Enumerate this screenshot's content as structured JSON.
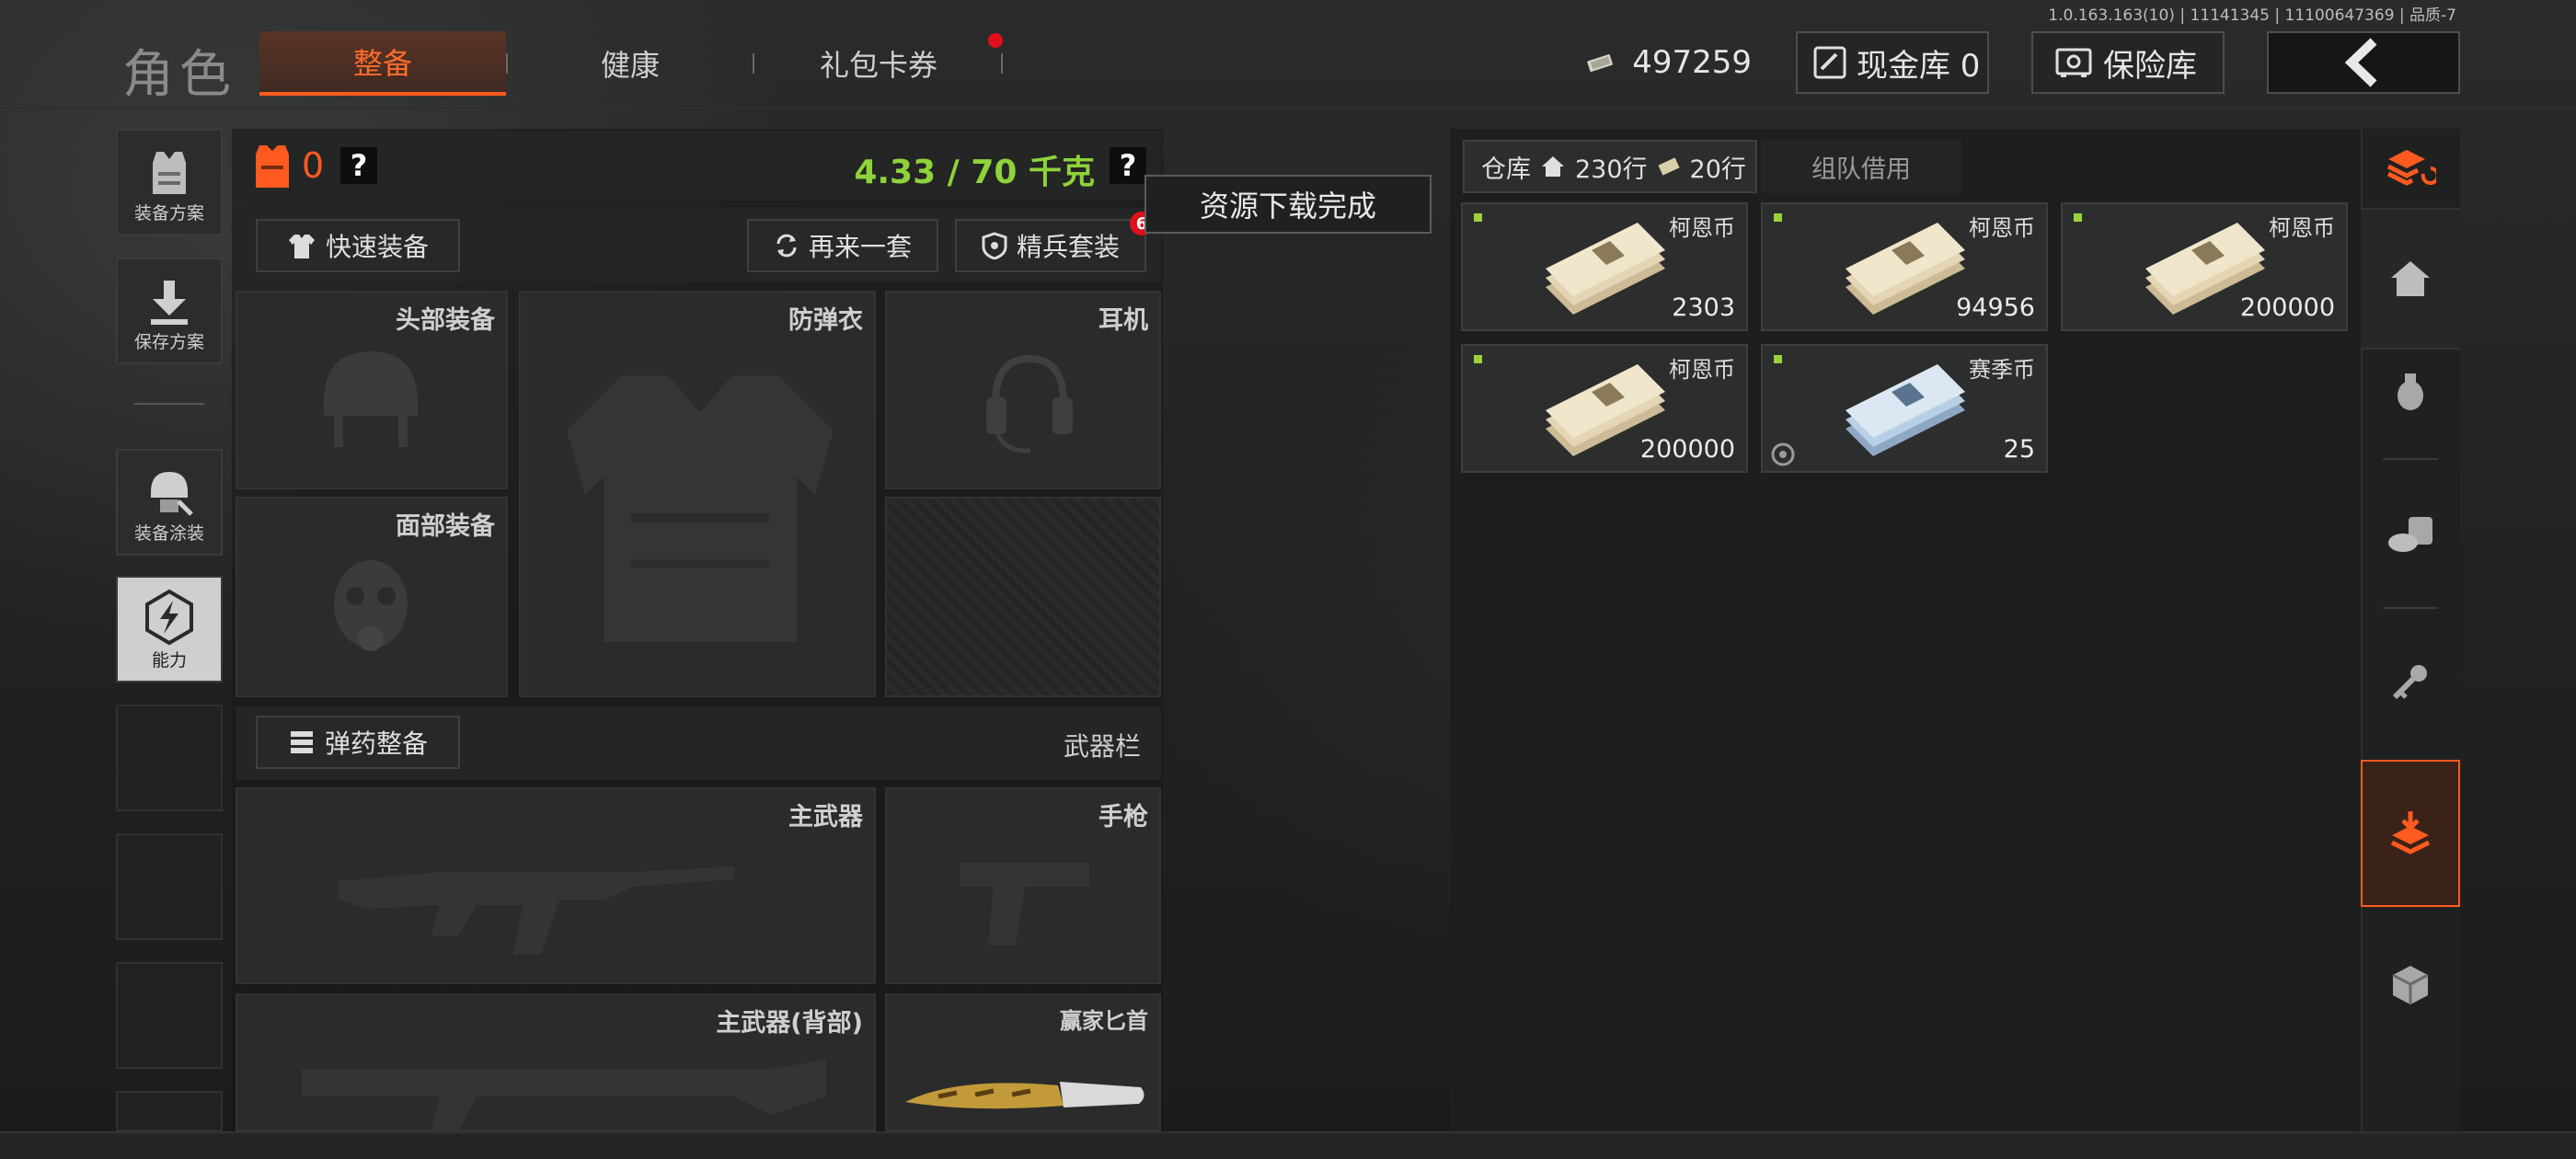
{
  "version_text": "1.0.163.163(10) | 11141345 | 11100647369 | 品质-7",
  "header": {
    "title": "角色",
    "tabs": [
      {
        "label": "整备",
        "active": true
      },
      {
        "label": "健康",
        "active": false
      },
      {
        "label": "礼包卡券",
        "active": false,
        "has_notification": true
      }
    ],
    "money": "497259",
    "cash_vault_label": "现金库 0",
    "safe_label": "保险库"
  },
  "side_menu": [
    {
      "label": "装备方案",
      "icon": "armor-vest-icon"
    },
    {
      "label": "保存方案",
      "icon": "download-icon"
    },
    {
      "label": "装备涂装",
      "icon": "helmet-paint-icon"
    },
    {
      "label": "能力",
      "icon": "lightning-hex-icon"
    }
  ],
  "loadout": {
    "armor_count": "0",
    "help_symbol": "?",
    "weight": "4.33 / 70 千克",
    "quick_equip_label": "快速装备",
    "again_label": "再来一套",
    "elite_set_label": "精兵套装",
    "elite_badge": "6",
    "slots": {
      "head": "头部装备",
      "vest": "防弹衣",
      "headset": "耳机",
      "face": "面部装备"
    },
    "ammo_label": "弹药整备",
    "weapon_bar_label": "武器栏",
    "weapons": {
      "primary": "主武器",
      "pistol": "手枪",
      "primary_back": "主武器(背部)",
      "melee": "赢家匕首"
    }
  },
  "toast": "资源下载完成",
  "warehouse": {
    "tab_label": "仓库",
    "rows_label": "230行",
    "extra_rows_label": "20行",
    "team_borrow_label": "组队借用",
    "items": [
      {
        "name": "柯恩币",
        "qty": "2303",
        "color": "#d9c8a4"
      },
      {
        "name": "柯恩币",
        "qty": "94956",
        "color": "#d9c8a4"
      },
      {
        "name": "柯恩币",
        "qty": "200000",
        "color": "#d9c8a4"
      },
      {
        "name": "柯恩币",
        "qty": "200000",
        "color": "#d9c8a4"
      },
      {
        "name": "赛季币",
        "qty": "25",
        "color": "#b8cfe6"
      }
    ]
  },
  "right_strip_icons": [
    "stack-refresh-icon",
    "home-icon",
    "grenade-icon",
    "coins-icon",
    "key-icon",
    "box-arrow-icon",
    "crate-icon"
  ],
  "colors": {
    "accent": "#ff5a1f",
    "weight_green": "#8ed33a",
    "notify_red": "#e0101a"
  }
}
